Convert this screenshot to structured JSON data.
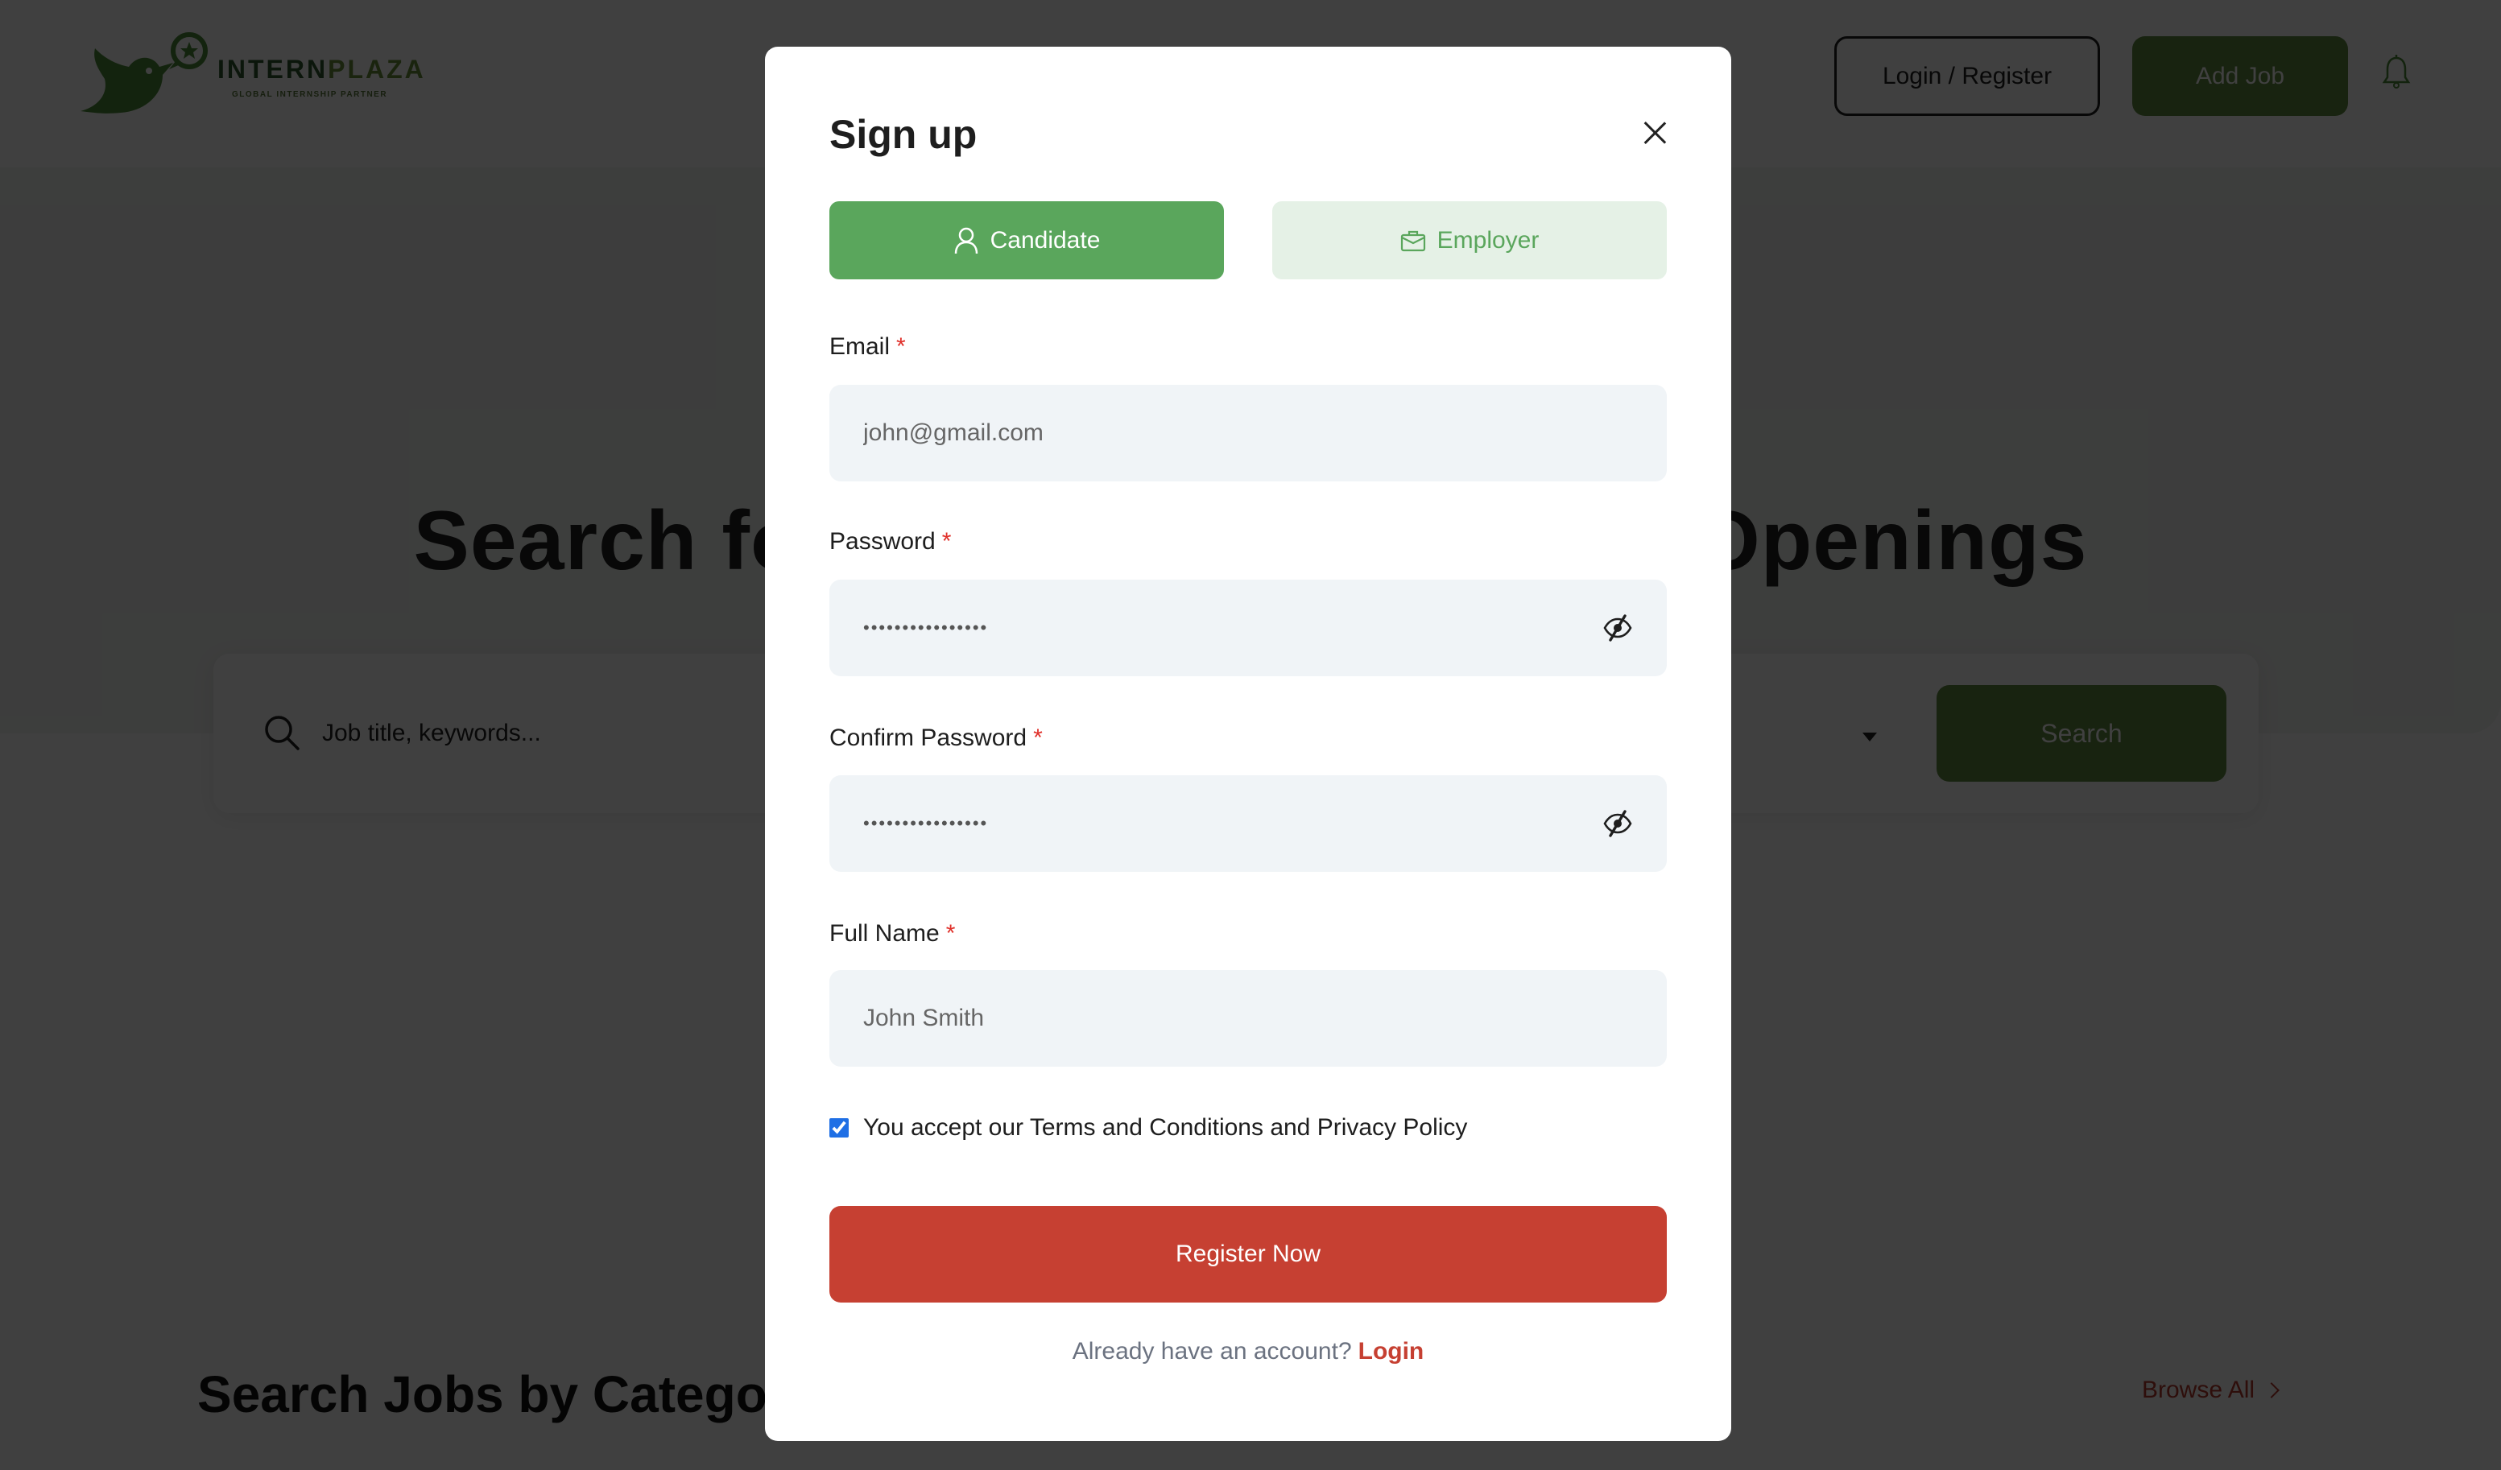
{
  "header": {
    "logo": {
      "name_part1": "INTERN",
      "name_part2": "PLAZA",
      "tagline": "GLOBAL INTERNSHIP PARTNER"
    },
    "login_register_label": "Login / Register",
    "add_job_label": "Add Job"
  },
  "hero": {
    "title": "Search for Jobs and Internship Openings",
    "search": {
      "placeholder": "Job title, keywords...",
      "button_label": "Search"
    }
  },
  "categories": {
    "title": "Search Jobs by Categories",
    "browse_all_label": "Browse All"
  },
  "modal": {
    "title": "Sign up",
    "tabs": [
      {
        "label": "Candidate",
        "icon": "user-icon",
        "active": true
      },
      {
        "label": "Employer",
        "icon": "briefcase-icon",
        "active": false
      }
    ],
    "fields": {
      "email": {
        "label": "Email",
        "required_mark": "*",
        "placeholder": "john@gmail.com",
        "value": ""
      },
      "password": {
        "label": "Password",
        "required_mark": "*",
        "value": "••••••••••••••••"
      },
      "confirm_password": {
        "label": "Confirm Password",
        "required_mark": "*",
        "value": "••••••••••••••••"
      },
      "full_name": {
        "label": "Full Name",
        "required_mark": "*",
        "placeholder": "John Smith",
        "value": ""
      }
    },
    "terms": {
      "label": "You accept our Terms and Conditions and Privacy Policy",
      "checked": true
    },
    "register_label": "Register Now",
    "already_text": "Already have an account?",
    "login_link_label": "Login"
  },
  "colors": {
    "brand_green": "#5aa65c",
    "brand_green_light": "#e5f1e6",
    "accent_red": "#c64032",
    "required_red": "#e0302a",
    "input_bg": "#f0f4f7",
    "header_button_green": "#608a40"
  }
}
